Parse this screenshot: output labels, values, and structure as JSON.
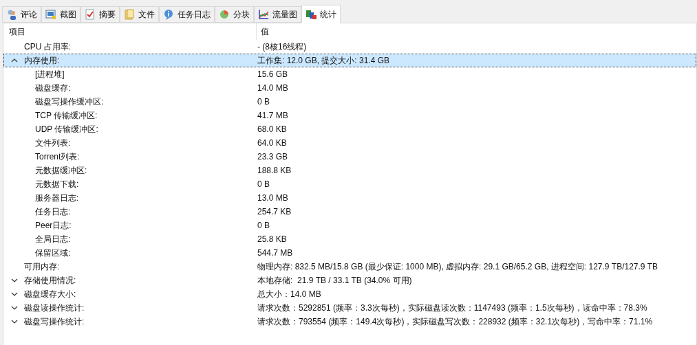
{
  "tabs": [
    {
      "label": "评论",
      "selected": false
    },
    {
      "label": "截图",
      "selected": false
    },
    {
      "label": "摘要",
      "selected": false
    },
    {
      "label": "文件",
      "selected": false
    },
    {
      "label": "任务日志",
      "selected": false
    },
    {
      "label": "分块",
      "selected": false
    },
    {
      "label": "流量图",
      "selected": false
    },
    {
      "label": "统计",
      "selected": true
    }
  ],
  "table": {
    "columns": [
      "项目",
      "值"
    ],
    "rows": [
      {
        "label": "CPU 占用率:",
        "value": "- (8核16线程)",
        "selected": false
      },
      {
        "label": "内存使用:",
        "value": "工作集: 12.0 GB, 提交大小: 31.4 GB",
        "selected": true,
        "expanded": true,
        "children": [
          {
            "label": "[进程堆]",
            "value": "15.6 GB",
            "selected": false
          },
          {
            "label": "磁盘缓存:",
            "value": "14.0 MB",
            "selected": false
          },
          {
            "label": "磁盘写操作缓冲区:",
            "value": "0 B",
            "selected": false
          },
          {
            "label": "TCP 传输缓冲区:",
            "value": "41.7 MB",
            "selected": false
          },
          {
            "label": "UDP 传输缓冲区:",
            "value": "68.0 KB",
            "selected": false
          },
          {
            "label": "文件列表:",
            "value": "64.0 KB",
            "selected": false
          },
          {
            "label": "Torrent列表:",
            "value": "23.3 GB",
            "selected": false
          },
          {
            "label": "元数据缓冲区:",
            "value": "188.8 KB",
            "selected": false
          },
          {
            "label": "元数据下载:",
            "value": "0 B",
            "selected": false
          },
          {
            "label": "服务器日志:",
            "value": "13.0 MB",
            "selected": false
          },
          {
            "label": "任务日志:",
            "value": "254.7 KB",
            "selected": false
          },
          {
            "label": "Peer日志:",
            "value": "0 B",
            "selected": false
          },
          {
            "label": "全局日志:",
            "value": "25.8 KB",
            "selected": false
          },
          {
            "label": "保留区域:",
            "value": "544.7 MB",
            "selected": false
          }
        ]
      },
      {
        "label": "可用内存:",
        "value": "物理内存: 832.5 MB/15.8 GB (最少保证: 1000 MB), 虚拟内存: 29.1 GB/65.2 GB, 进程空间: 127.9 TB/127.9 TB",
        "selected": false
      },
      {
        "label": "存储使用情况:",
        "value": "本地存储:  21.9 TB / 33.1 TB (34.0% 可用)",
        "selected": false,
        "expanded": false
      },
      {
        "label": "磁盘缓存大小:",
        "value": "总大小：14.0 MB",
        "selected": false,
        "expanded": false
      },
      {
        "label": "磁盘读操作统计:",
        "value": "请求次数：5292851 (频率：3.3次每秒)，实际磁盘读次数：1147493 (频率：1.5次每秒)，读命中率：78.3%",
        "selected": false,
        "expanded": false
      },
      {
        "label": "磁盘写操作统计:",
        "value": "请求次数：793554 (频率：149.4次每秒)，实际磁盘写次数：228932 (频率：32.1次每秒)，写命中率：71.1%",
        "selected": false,
        "expanded": false
      }
    ]
  }
}
